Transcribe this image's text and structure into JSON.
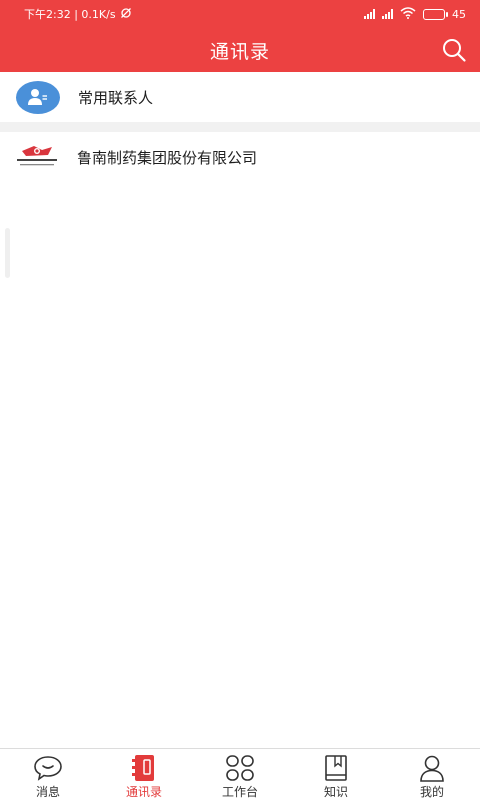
{
  "status_bar": {
    "time_speed": "下午2:32 | 0.1K/s",
    "battery": "45",
    "battery_level": 0.45
  },
  "header": {
    "title": "通讯录",
    "search_icon": "search-icon"
  },
  "contacts": {
    "frequent": {
      "label": "常用联系人",
      "icon": "contact-card-icon"
    },
    "organization": {
      "label": "鲁南制药集团股份有限公司",
      "icon": "company-logo"
    }
  },
  "tabs": [
    {
      "label": "消息",
      "icon": "chat-bubble-icon",
      "active": false
    },
    {
      "label": "通讯录",
      "icon": "address-book-icon",
      "active": true
    },
    {
      "label": "工作台",
      "icon": "grid-icon",
      "active": false
    },
    {
      "label": "知识",
      "icon": "book-icon",
      "active": false
    },
    {
      "label": "我的",
      "icon": "person-icon",
      "active": false
    }
  ],
  "colors": {
    "brand": "#ec4141",
    "avatar_blue": "#4a90d9",
    "active_tab": "#e23b3b"
  }
}
